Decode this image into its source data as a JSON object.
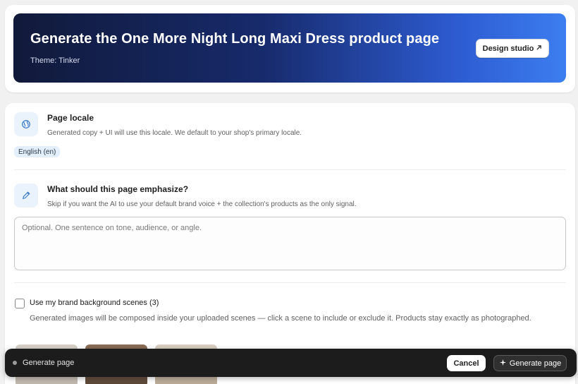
{
  "header": {
    "title": "Generate the One More Night Long Maxi Dress product page",
    "theme_text": "Theme: Tinker",
    "design_studio_label": "Design studio",
    "design_studio_icon": "external-arrow-icon"
  },
  "locale": {
    "title": "Page locale",
    "description": "Generated copy + UI will use this locale. We default to your shop's primary locale.",
    "badge": "English (en)",
    "icon": "globe-icon"
  },
  "emphasis": {
    "title": "What should this page emphasize?",
    "description": "Skip if you want the AI to use your default brand voice + the collection's products as the only signal.",
    "placeholder": "Optional. One sentence on tone, audience, or angle.",
    "icon": "pencil-icon"
  },
  "scenes": {
    "label": "Use my brand background scenes (3)",
    "description": "Generated images will be composed inside your uploaded scenes — click a scene to include or exclude it. Products stay exactly as photographed.",
    "checked": false
  },
  "action_bar": {
    "status": "Generate page",
    "cancel_label": "Cancel",
    "generate_label": "Generate page",
    "generate_icon": "sparkle-icon"
  },
  "colors": {
    "hero_gradient_start": "#111a3a",
    "hero_gradient_end": "#3c7ef0",
    "badge_bg": "#e3effa",
    "bar_bg": "#1c1c1c"
  }
}
